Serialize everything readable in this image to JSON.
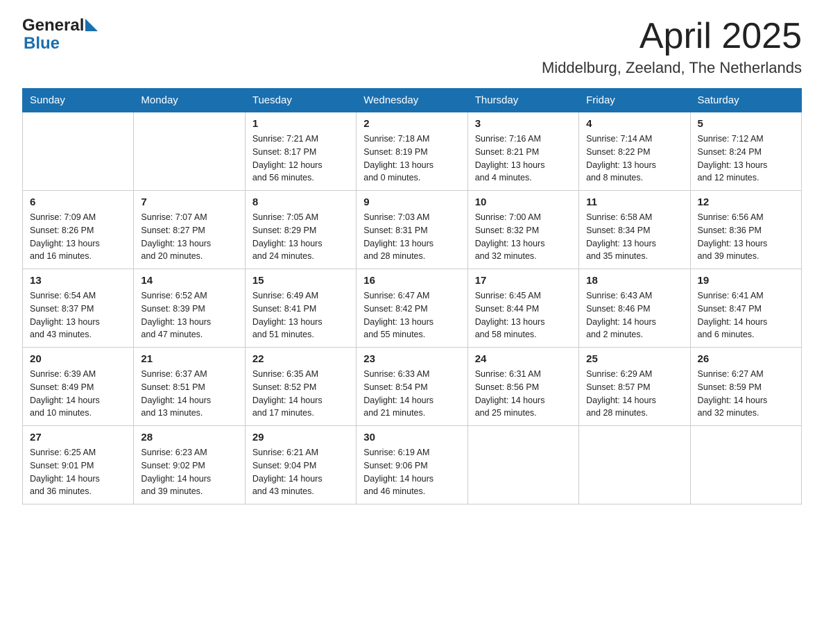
{
  "header": {
    "title": "April 2025",
    "location": "Middelburg, Zeeland, The Netherlands",
    "logo_general": "General",
    "logo_blue": "Blue"
  },
  "calendar": {
    "days_of_week": [
      "Sunday",
      "Monday",
      "Tuesday",
      "Wednesday",
      "Thursday",
      "Friday",
      "Saturday"
    ],
    "weeks": [
      [
        {
          "day": "",
          "info": ""
        },
        {
          "day": "",
          "info": ""
        },
        {
          "day": "1",
          "info": "Sunrise: 7:21 AM\nSunset: 8:17 PM\nDaylight: 12 hours\nand 56 minutes."
        },
        {
          "day": "2",
          "info": "Sunrise: 7:18 AM\nSunset: 8:19 PM\nDaylight: 13 hours\nand 0 minutes."
        },
        {
          "day": "3",
          "info": "Sunrise: 7:16 AM\nSunset: 8:21 PM\nDaylight: 13 hours\nand 4 minutes."
        },
        {
          "day": "4",
          "info": "Sunrise: 7:14 AM\nSunset: 8:22 PM\nDaylight: 13 hours\nand 8 minutes."
        },
        {
          "day": "5",
          "info": "Sunrise: 7:12 AM\nSunset: 8:24 PM\nDaylight: 13 hours\nand 12 minutes."
        }
      ],
      [
        {
          "day": "6",
          "info": "Sunrise: 7:09 AM\nSunset: 8:26 PM\nDaylight: 13 hours\nand 16 minutes."
        },
        {
          "day": "7",
          "info": "Sunrise: 7:07 AM\nSunset: 8:27 PM\nDaylight: 13 hours\nand 20 minutes."
        },
        {
          "day": "8",
          "info": "Sunrise: 7:05 AM\nSunset: 8:29 PM\nDaylight: 13 hours\nand 24 minutes."
        },
        {
          "day": "9",
          "info": "Sunrise: 7:03 AM\nSunset: 8:31 PM\nDaylight: 13 hours\nand 28 minutes."
        },
        {
          "day": "10",
          "info": "Sunrise: 7:00 AM\nSunset: 8:32 PM\nDaylight: 13 hours\nand 32 minutes."
        },
        {
          "day": "11",
          "info": "Sunrise: 6:58 AM\nSunset: 8:34 PM\nDaylight: 13 hours\nand 35 minutes."
        },
        {
          "day": "12",
          "info": "Sunrise: 6:56 AM\nSunset: 8:36 PM\nDaylight: 13 hours\nand 39 minutes."
        }
      ],
      [
        {
          "day": "13",
          "info": "Sunrise: 6:54 AM\nSunset: 8:37 PM\nDaylight: 13 hours\nand 43 minutes."
        },
        {
          "day": "14",
          "info": "Sunrise: 6:52 AM\nSunset: 8:39 PM\nDaylight: 13 hours\nand 47 minutes."
        },
        {
          "day": "15",
          "info": "Sunrise: 6:49 AM\nSunset: 8:41 PM\nDaylight: 13 hours\nand 51 minutes."
        },
        {
          "day": "16",
          "info": "Sunrise: 6:47 AM\nSunset: 8:42 PM\nDaylight: 13 hours\nand 55 minutes."
        },
        {
          "day": "17",
          "info": "Sunrise: 6:45 AM\nSunset: 8:44 PM\nDaylight: 13 hours\nand 58 minutes."
        },
        {
          "day": "18",
          "info": "Sunrise: 6:43 AM\nSunset: 8:46 PM\nDaylight: 14 hours\nand 2 minutes."
        },
        {
          "day": "19",
          "info": "Sunrise: 6:41 AM\nSunset: 8:47 PM\nDaylight: 14 hours\nand 6 minutes."
        }
      ],
      [
        {
          "day": "20",
          "info": "Sunrise: 6:39 AM\nSunset: 8:49 PM\nDaylight: 14 hours\nand 10 minutes."
        },
        {
          "day": "21",
          "info": "Sunrise: 6:37 AM\nSunset: 8:51 PM\nDaylight: 14 hours\nand 13 minutes."
        },
        {
          "day": "22",
          "info": "Sunrise: 6:35 AM\nSunset: 8:52 PM\nDaylight: 14 hours\nand 17 minutes."
        },
        {
          "day": "23",
          "info": "Sunrise: 6:33 AM\nSunset: 8:54 PM\nDaylight: 14 hours\nand 21 minutes."
        },
        {
          "day": "24",
          "info": "Sunrise: 6:31 AM\nSunset: 8:56 PM\nDaylight: 14 hours\nand 25 minutes."
        },
        {
          "day": "25",
          "info": "Sunrise: 6:29 AM\nSunset: 8:57 PM\nDaylight: 14 hours\nand 28 minutes."
        },
        {
          "day": "26",
          "info": "Sunrise: 6:27 AM\nSunset: 8:59 PM\nDaylight: 14 hours\nand 32 minutes."
        }
      ],
      [
        {
          "day": "27",
          "info": "Sunrise: 6:25 AM\nSunset: 9:01 PM\nDaylight: 14 hours\nand 36 minutes."
        },
        {
          "day": "28",
          "info": "Sunrise: 6:23 AM\nSunset: 9:02 PM\nDaylight: 14 hours\nand 39 minutes."
        },
        {
          "day": "29",
          "info": "Sunrise: 6:21 AM\nSunset: 9:04 PM\nDaylight: 14 hours\nand 43 minutes."
        },
        {
          "day": "30",
          "info": "Sunrise: 6:19 AM\nSunset: 9:06 PM\nDaylight: 14 hours\nand 46 minutes."
        },
        {
          "day": "",
          "info": ""
        },
        {
          "day": "",
          "info": ""
        },
        {
          "day": "",
          "info": ""
        }
      ]
    ]
  }
}
